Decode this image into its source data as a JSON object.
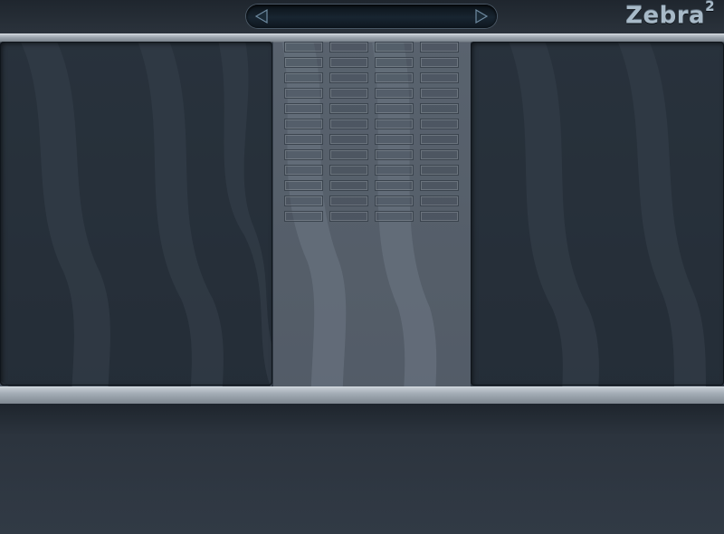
{
  "app": {
    "logo_text": "Zebra",
    "logo_superscript": "2"
  },
  "preset_browser": {
    "preset_name": "",
    "prev_icon": "triangle-left-icon",
    "next_icon": "triangle-right-icon"
  },
  "module_grid": {
    "columns": 4,
    "rows": 12
  },
  "colors": {
    "background": "#323b46",
    "rail": "#a2abb4",
    "logo": "#a8bac8",
    "preset_field": "#0f1a24"
  }
}
